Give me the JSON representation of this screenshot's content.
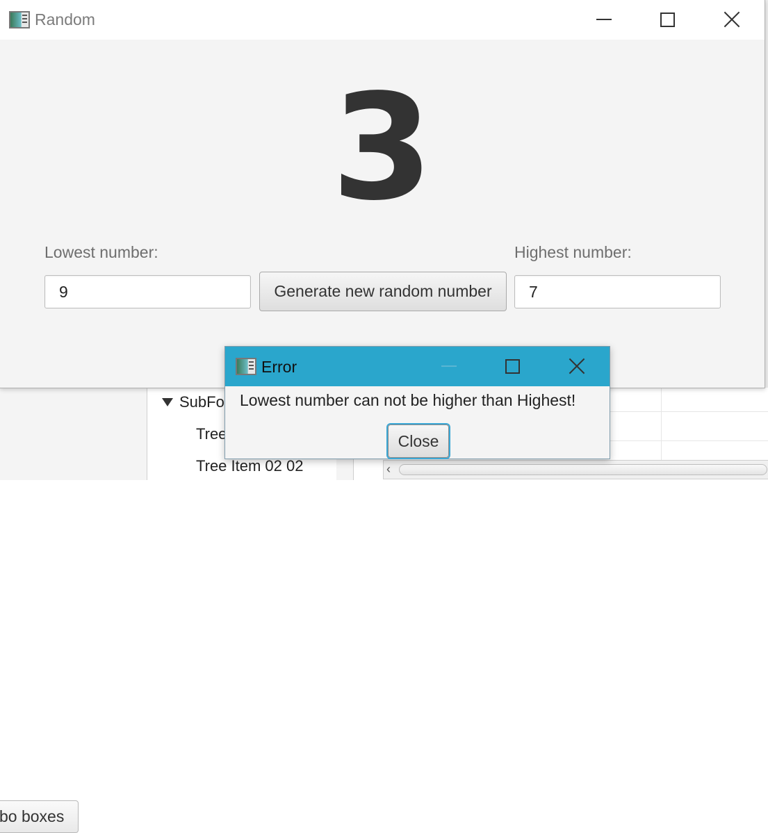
{
  "main_window": {
    "title": "Random",
    "generated_number": "3",
    "lowest": {
      "label": "Lowest number:",
      "value": "9"
    },
    "highest": {
      "label": "Highest number:",
      "value": "7"
    },
    "generate_button_label": "Generate new random number"
  },
  "error_dialog": {
    "title": "Error",
    "message": "Lowest number can not be higher than Highest!",
    "close_button_label": "Close"
  },
  "background_app": {
    "combo_button_label": "bo boxes",
    "tree_items": [
      {
        "label": "SubFo",
        "expanded": true
      },
      {
        "label": "Tree"
      },
      {
        "label": "Tree Item 02 02"
      }
    ]
  },
  "colors": {
    "dialog_titlebar": "#2aa6cc",
    "focus_ring": "#3ba8d6",
    "window_background": "#f4f4f4",
    "number_color": "#333333"
  },
  "icons": [
    "app-icon",
    "minimize-icon",
    "maximize-icon",
    "close-icon",
    "tree-expand-arrow-icon",
    "scroll-left-arrow-icon"
  ]
}
